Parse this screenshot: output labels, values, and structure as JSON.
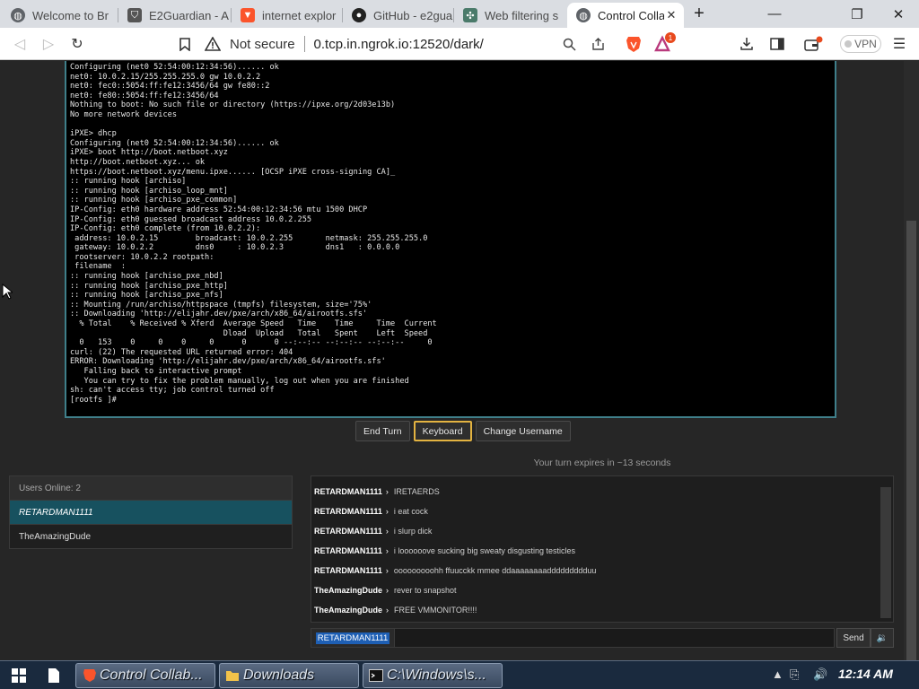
{
  "browser": {
    "tabs": [
      {
        "title": "Welcome to Br",
        "icon": "globe-icon"
      },
      {
        "title": "E2Guardian - A",
        "icon": "shield-icon"
      },
      {
        "title": "internet explor",
        "icon": "brave-lion-icon"
      },
      {
        "title": "GitHub - e2gua",
        "icon": "github-icon"
      },
      {
        "title": "Web filtering s",
        "icon": "network-icon"
      },
      {
        "title": "Control Colla",
        "icon": "globe-icon"
      }
    ],
    "new_tab": "+",
    "minimize": "—",
    "restore": "❐",
    "close": "✕",
    "url_security": "Not secure",
    "url": "0.tcp.in.ngrok.io:12520/dark/",
    "rewards_badge": "1",
    "vpn_label": "VPN"
  },
  "terminal": {
    "lines": [
      "Configuring (net0 52:54:00:12:34:56)...... ok",
      "net0: 10.0.2.15/255.255.255.0 gw 10.0.2.2",
      "net0: fec0::5054:ff:fe12:3456/64 gw fe80::2",
      "net0: fe80::5054:ff:fe12:3456/64",
      "Nothing to boot: No such file or directory (https://ipxe.org/2d03e13b)",
      "No more network devices",
      "",
      "iPXE> dhcp",
      "Configuring (net0 52:54:00:12:34:56)...... ok",
      "iPXE> boot http://boot.netboot.xyz",
      "http://boot.netboot.xyz... ok",
      "https://boot.netboot.xyz/menu.ipxe...... [OCSP iPXE cross-signing CA]_",
      ":: running hook [archiso]",
      ":: running hook [archiso_loop_mnt]",
      ":: running hook [archiso_pxe_common]",
      "IP-Config: eth0 hardware address 52:54:00:12:34:56 mtu 1500 DHCP",
      "IP-Config: eth0 guessed broadcast address 10.0.2.255",
      "IP-Config: eth0 complete (from 10.0.2.2):",
      " address: 10.0.2.15        broadcast: 10.0.2.255       netmask: 255.255.255.0",
      " gateway: 10.0.2.2         dns0     : 10.0.2.3         dns1   : 0.0.0.0",
      " rootserver: 10.0.2.2 rootpath:",
      " filename  :",
      ":: running hook [archiso_pxe_nbd]",
      ":: running hook [archiso_pxe_http]",
      ":: running hook [archiso_pxe_nfs]",
      ":: Mounting /run/archiso/httpspace (tmpfs) filesystem, size='75%'",
      ":: Downloading 'http://elijahr.dev/pxe/arch/x86_64/airootfs.sfs'",
      "  % Total    % Received % Xferd  Average Speed   Time    Time     Time  Current",
      "                                 Dload  Upload   Total   Spent    Left  Speed",
      "  0   153    0     0    0     0      0      0 --:--:-- --:--:-- --:--:--     0",
      "curl: (22) The requested URL returned error: 404",
      "ERROR: Downloading 'http://elijahr.dev/pxe/arch/x86_64/airootfs.sfs'",
      "   Falling back to interactive prompt",
      "   You can try to fix the problem manually, log out when you are finished",
      "sh: can't access tty; job control turned off",
      "[rootfs ]#"
    ]
  },
  "controls": {
    "end_turn": "End Turn",
    "keyboard": "Keyboard",
    "change_username": "Change Username"
  },
  "turn_status": "Your turn expires in ~13 seconds",
  "users": {
    "header": "Users Online: 2",
    "list": [
      "RETARDMAN1111",
      "TheAmazingDude"
    ]
  },
  "chat": {
    "messages": [
      {
        "user": "RETARDMAN1111",
        "sep": "›",
        "text": "IRETAERDS"
      },
      {
        "user": "RETARDMAN1111",
        "sep": "›",
        "text": "i eat cock"
      },
      {
        "user": "RETARDMAN1111",
        "sep": "›",
        "text": "i slurp dick"
      },
      {
        "user": "RETARDMAN1111",
        "sep": "›",
        "text": "i loooooove sucking big sweaty disgusting testicles"
      },
      {
        "user": "RETARDMAN1111",
        "sep": "›",
        "text": "ooooooooohh ffuucckk mmee ddaaaaaaaaddddddddduu"
      },
      {
        "user": "TheAmazingDude",
        "sep": "›",
        "text": "rever to snapshot"
      },
      {
        "user": "TheAmazingDude",
        "sep": "›",
        "text": "FREE VMMONITOR!!!!"
      }
    ],
    "username": "RETARDMAN1111",
    "input_value": "",
    "send_label": "Send",
    "voice_label": "🔉"
  },
  "taskbar": {
    "items": [
      {
        "label": "Control Collab...",
        "icon": "brave-icon"
      },
      {
        "label": "Downloads",
        "icon": "folder-icon"
      },
      {
        "label": "C:\\Windows\\s...",
        "icon": "cmd-icon"
      }
    ],
    "clock": "12:14 AM"
  }
}
